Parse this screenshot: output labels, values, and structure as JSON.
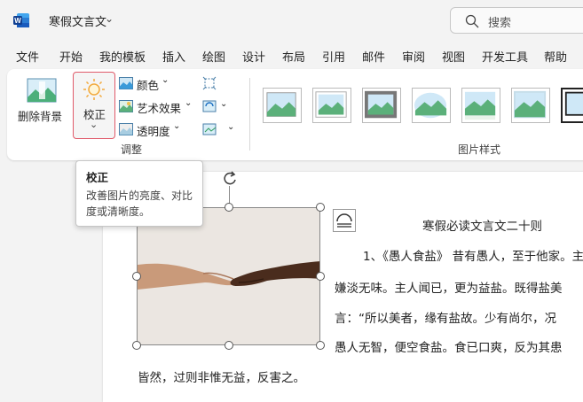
{
  "titlebar": {
    "doc_title": "寒假文言文",
    "search_placeholder": "搜索"
  },
  "menu": [
    "文件",
    "开始",
    "我的模板",
    "插入",
    "绘图",
    "设计",
    "布局",
    "引用",
    "邮件",
    "审阅",
    "视图",
    "开发工具",
    "帮助"
  ],
  "ribbon": {
    "remove_bg": "删除背景",
    "correct": "校正",
    "color": "颜色",
    "artistic": "艺术效果",
    "transparency": "透明度",
    "group_adjust": "调整",
    "group_styles": "图片样式"
  },
  "tooltip": {
    "title": "校正",
    "body": "改善图片的亮度、对比度或清晰度。"
  },
  "document": {
    "heading": "寒假必读文言文二十则",
    "lines": [
      "1、《愚人食盐》 昔有愚人，至于他家。主",
      "嫌淡无味。主人闻已，更为益盐。既得盐美",
      "言：“所以美者，缘有盐故。少有尚尔，况",
      "愚人无智，便空食盐。食已口爽，反为其患",
      "皆然，过则非惟无益，反害之。"
    ]
  },
  "colors": {
    "accent": "#185abd",
    "highlight_border": "#e05a6a"
  }
}
